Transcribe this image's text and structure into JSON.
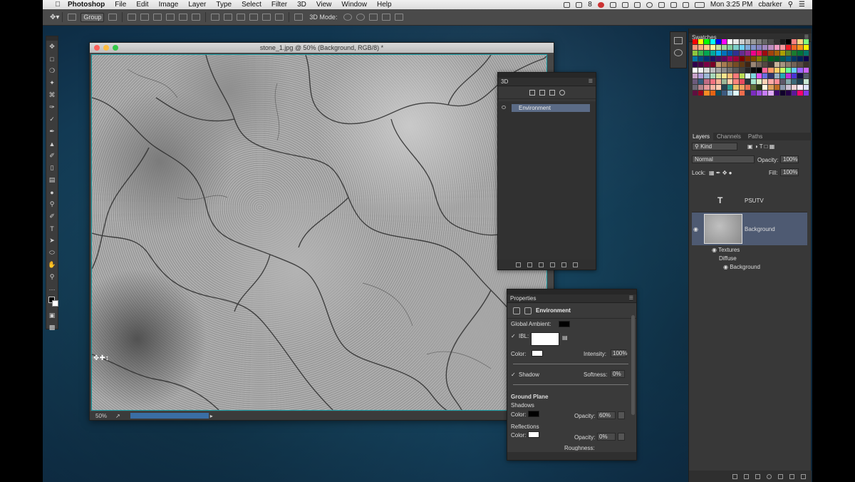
{
  "menubar": {
    "app": "Photoshop",
    "items": [
      "File",
      "Edit",
      "Image",
      "Layer",
      "Type",
      "Select",
      "Filter",
      "3D",
      "View",
      "Window",
      "Help"
    ],
    "badge": "8",
    "clock": "Mon 3:25 PM",
    "user": "cbarker"
  },
  "options": {
    "auto_select": "Group",
    "mode_label": "3D Mode:"
  },
  "document": {
    "title": "stone_1.jpg @ 50% (Background, RGB/8) *",
    "zoom": "50%"
  },
  "panel3d": {
    "tab": "3D",
    "scene_item": "Environment"
  },
  "properties": {
    "tab": "Properties",
    "header": "Environment",
    "global_ambient": "Global Ambient:",
    "ibl": "IBL:",
    "color": "Color:",
    "intensity_label": "Intensity:",
    "intensity": "100%",
    "shadow": "Shadow",
    "softness_label": "Softness:",
    "softness": "0%",
    "ground_plane": "Ground Plane",
    "shadows": "Shadows",
    "shadows_color": "Color:",
    "shadows_opacity_label": "Opacity:",
    "shadows_opacity": "60%",
    "reflections": "Reflections",
    "reflections_color": "Color:",
    "reflections_opacity_label": "Opacity:",
    "reflections_opacity": "0%",
    "roughness": "Roughness:"
  },
  "swatches": {
    "tab": "Swatches",
    "colors": [
      "#ff0000",
      "#ffff00",
      "#00ff00",
      "#00ffff",
      "#0000ff",
      "#ff00ff",
      "#ffffff",
      "#e6e6e6",
      "#cccccc",
      "#b3b3b3",
      "#999999",
      "#808080",
      "#666666",
      "#4d4d4d",
      "#333333",
      "#1a1a1a",
      "#000000",
      "#ff8080",
      "#ffd480",
      "#80ff80",
      "#f7977a",
      "#f9ad81",
      "#fdc68a",
      "#fff79a",
      "#c4df9b",
      "#a2d39c",
      "#82ca9d",
      "#7bcdc8",
      "#6ecff6",
      "#7ea7d8",
      "#8493ca",
      "#8882be",
      "#a187be",
      "#bc8dbf",
      "#f49ac2",
      "#f6989d",
      "#ed1c24",
      "#f26522",
      "#f7941d",
      "#fff200",
      "#8dc63f",
      "#39b54a",
      "#00a651",
      "#00a99d",
      "#00aeef",
      "#0072bc",
      "#0054a6",
      "#2e3192",
      "#662d91",
      "#92278f",
      "#ec008c",
      "#ed145b",
      "#9e0b0f",
      "#a0410d",
      "#a36209",
      "#aba000",
      "#598527",
      "#1a7b30",
      "#007236",
      "#00746b",
      "#0076a3",
      "#004a80",
      "#003471",
      "#1b1464",
      "#440e62",
      "#630460",
      "#9e005d",
      "#9e0039",
      "#790000",
      "#7b2e00",
      "#7d4900",
      "#827b00",
      "#406618",
      "#005e20",
      "#005826",
      "#005952",
      "#005b7f",
      "#003663",
      "#002157",
      "#0d004c",
      "#32004b",
      "#4b0049",
      "#7b0046",
      "#7a0026",
      "#c69c6d",
      "#a67c52",
      "#8c6239",
      "#754c24",
      "#603913",
      "#3c2415",
      "#998675",
      "#736357",
      "#534741",
      "#362f2d",
      "#c7b299",
      "#a69580",
      "#8c7b6b",
      "#736357",
      "#594a42",
      "#3b3129",
      "#ffffff",
      "#f2f2f2",
      "#d9d9d9",
      "#bfbfbf",
      "#a6a6a6",
      "#8c8c8c",
      "#737373",
      "#595959",
      "#404040",
      "#262626",
      "#0d0d0d",
      "#000000",
      "#ff6699",
      "#ff9966",
      "#ffcc66",
      "#ccff66",
      "#66ff99",
      "#66ccff",
      "#9966ff",
      "#cc66ff",
      "#c8a2c8",
      "#b19cd9",
      "#9bb7d4",
      "#a8d8b9",
      "#d4e09b",
      "#f6e58d",
      "#ffbe76",
      "#ff7979",
      "#badc58",
      "#dff9fb",
      "#7ed6df",
      "#e056fd",
      "#686de0",
      "#30336b",
      "#95afc0",
      "#22a6b3",
      "#be2edd",
      "#4834d4",
      "#130f40",
      "#535c68",
      "#6c5b7b",
      "#355c7d",
      "#c06c84",
      "#f67280",
      "#f8b195",
      "#99b898",
      "#feceab",
      "#ff847c",
      "#e84a5f",
      "#2a363b",
      "#a8e6cf",
      "#dcedc1",
      "#ffd3b6",
      "#ffaaa5",
      "#ff8b94",
      "#5e5768",
      "#84a9ac",
      "#3b6978",
      "#204051",
      "#cae8d5",
      "#6d6875",
      "#b5838d",
      "#e5989b",
      "#ffb4a2",
      "#ffcdb2",
      "#264653",
      "#2a9d8f",
      "#e9c46a",
      "#f4a261",
      "#e76f51",
      "#606c38",
      "#283618",
      "#fefae0",
      "#dda15e",
      "#bc6c25",
      "#8e9aaf",
      "#cbc0d3",
      "#efd3d7",
      "#feeafa",
      "#dee2ff",
      "#5f0f40",
      "#9a031e",
      "#fb8b24",
      "#e36414",
      "#0f4c5c",
      "#3d5a80",
      "#98c1d9",
      "#e0fbfc",
      "#ee6c4d",
      "#293241",
      "#7b2cbf",
      "#9d4edd",
      "#c77dff",
      "#e0aaff",
      "#3c096c",
      "#10002b",
      "#240046",
      "#5a189a",
      "#ff006e",
      "#8338ec"
    ]
  },
  "layers": {
    "tabs": [
      "Layers",
      "Channels",
      "Paths"
    ],
    "filter": "Kind",
    "blend": "Normal",
    "opacity_label": "Opacity:",
    "opacity": "100%",
    "lock_label": "Lock:",
    "fill_label": "Fill:",
    "fill": "100%",
    "type_layer": "PSUTV",
    "bg_layer": "Background",
    "sub1": "Textures",
    "sub2": "Diffuse",
    "sub3": "Background"
  }
}
